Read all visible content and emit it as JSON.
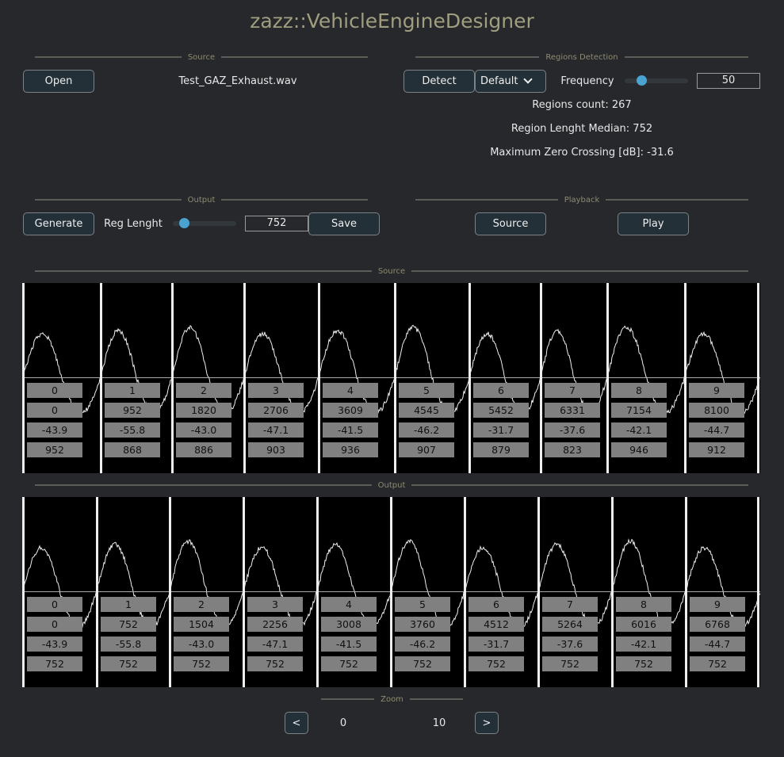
{
  "app_title": "zazz::VehicleEngineDesigner",
  "source_section": {
    "header": "Source",
    "open_label": "Open",
    "file_name": "Test_GAZ_Exhaust.wav"
  },
  "detection_section": {
    "header": "Regions Detection",
    "detect_label": "Detect",
    "mode_value": "Default",
    "frequency_label": "Frequency",
    "frequency_value": "50",
    "frequency_fraction": 0.27,
    "regions_count": "Regions count: 267",
    "median": "Region Lenght Median: 752",
    "max_zero_crossing": "Maximum Zero Crossing [dB]: -31.6"
  },
  "output_section": {
    "header": "Output",
    "generate_label": "Generate",
    "reg_length_label": "Reg Lenght",
    "reg_length_value": "752",
    "reg_length_fraction": 0.18,
    "save_label": "Save"
  },
  "playback_section": {
    "header": "Playback",
    "source_label": "Source",
    "play_label": "Play"
  },
  "source_view": {
    "header": "Source",
    "regions": [
      {
        "index": "0",
        "start": "0",
        "db": "-43.9",
        "length": "952"
      },
      {
        "index": "1",
        "start": "952",
        "db": "-55.8",
        "length": "868"
      },
      {
        "index": "2",
        "start": "1820",
        "db": "-43.0",
        "length": "886"
      },
      {
        "index": "3",
        "start": "2706",
        "db": "-47.1",
        "length": "903"
      },
      {
        "index": "4",
        "start": "3609",
        "db": "-41.5",
        "length": "936"
      },
      {
        "index": "5",
        "start": "4545",
        "db": "-46.2",
        "length": "907"
      },
      {
        "index": "6",
        "start": "5452",
        "db": "-31.7",
        "length": "879"
      },
      {
        "index": "7",
        "start": "6331",
        "db": "-37.6",
        "length": "823"
      },
      {
        "index": "8",
        "start": "7154",
        "db": "-42.1",
        "length": "946"
      },
      {
        "index": "9",
        "start": "8100",
        "db": "-44.7",
        "length": "912"
      }
    ]
  },
  "output_view": {
    "header": "Output",
    "regions": [
      {
        "index": "0",
        "start": "0",
        "db": "-43.9",
        "length": "752"
      },
      {
        "index": "1",
        "start": "752",
        "db": "-55.8",
        "length": "752"
      },
      {
        "index": "2",
        "start": "1504",
        "db": "-43.0",
        "length": "752"
      },
      {
        "index": "3",
        "start": "2256",
        "db": "-47.1",
        "length": "752"
      },
      {
        "index": "4",
        "start": "3008",
        "db": "-41.5",
        "length": "752"
      },
      {
        "index": "5",
        "start": "3760",
        "db": "-46.2",
        "length": "752"
      },
      {
        "index": "6",
        "start": "4512",
        "db": "-31.7",
        "length": "752"
      },
      {
        "index": "7",
        "start": "5264",
        "db": "-37.6",
        "length": "752"
      },
      {
        "index": "8",
        "start": "6016",
        "db": "-42.1",
        "length": "752"
      },
      {
        "index": "9",
        "start": "6768",
        "db": "-44.7",
        "length": "752"
      }
    ]
  },
  "zoom": {
    "header": "Zoom",
    "prev_label": "<",
    "next_label": ">",
    "start": "0",
    "end": "10"
  },
  "colors": {
    "background": "#27282c",
    "accent": "#4aa3d1",
    "title": "#a09e7e"
  }
}
